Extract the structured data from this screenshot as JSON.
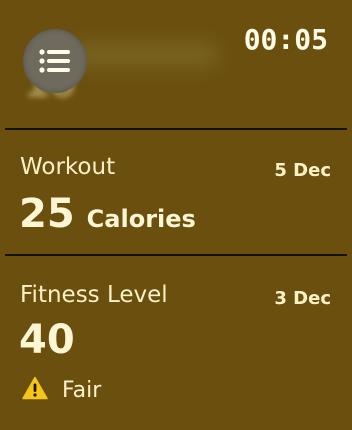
{
  "header": {
    "time": "00:05",
    "menu_icon": "list-icon"
  },
  "workout": {
    "title": "Workout",
    "date": "5 Dec",
    "value": "25",
    "unit": "Calories"
  },
  "fitness": {
    "title": "Fitness Level",
    "date": "3 Dec",
    "value": "40",
    "status_label": "Fair",
    "status_icon": "warning-icon"
  },
  "colors": {
    "background": "#6a4f0e",
    "divider": "#151105",
    "text": "#fff6d3",
    "warning": "#f5c518"
  }
}
